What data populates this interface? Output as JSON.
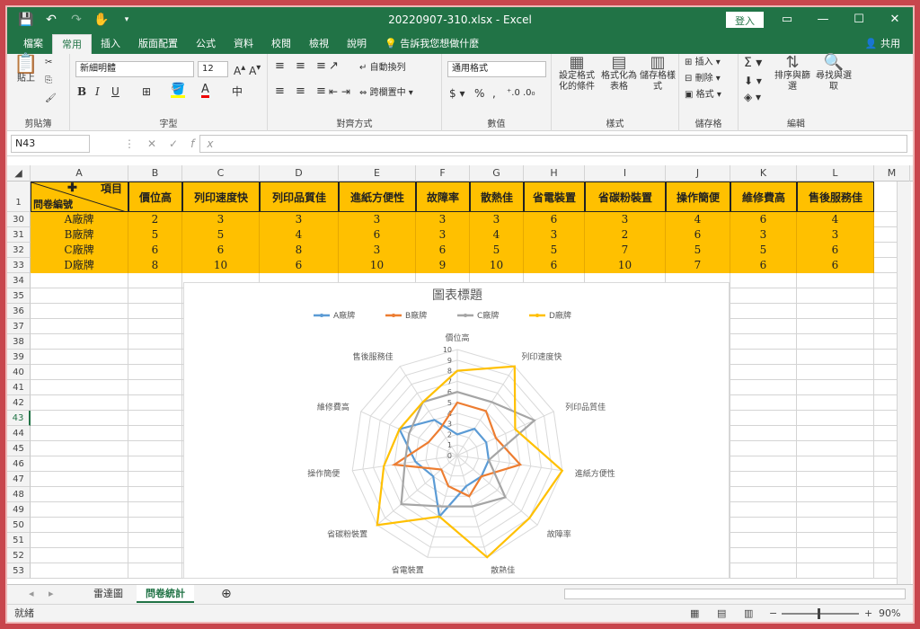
{
  "window": {
    "title": "20220907-310.xlsx  -  Excel",
    "signin": "登入"
  },
  "tabs": [
    "檔案",
    "常用",
    "插入",
    "版面配置",
    "公式",
    "資料",
    "校閱",
    "檢視",
    "說明"
  ],
  "tell_me": "告訴我您想做什麼",
  "share": "共用",
  "ribbon": {
    "clipboard": {
      "paste": "貼上",
      "label": "剪貼簿"
    },
    "font": {
      "name": "新細明體",
      "size": "12",
      "label": "字型"
    },
    "alignment": {
      "wrap": "自動換列",
      "merge": "跨欄置中",
      "label": "對齊方式"
    },
    "number": {
      "format": "通用格式",
      "label": "數值"
    },
    "styles": {
      "conditional": "設定格式化的條件",
      "as_table": "格式化為表格",
      "cell_styles": "儲存格樣式",
      "label": "樣式"
    },
    "cells": {
      "insert": "插入",
      "delete": "刪除",
      "format": "格式",
      "label": "儲存格"
    },
    "editing": {
      "sort": "排序與篩選",
      "find": "尋找與選取",
      "label": "編輯"
    }
  },
  "formula_bar": {
    "name_box": "N43",
    "formula": ""
  },
  "columns": [
    "A",
    "B",
    "C",
    "D",
    "E",
    "F",
    "G",
    "H",
    "I",
    "J",
    "K",
    "L",
    "M"
  ],
  "header_row": {
    "corner_top": "項目",
    "corner_bottom": "問卷編號",
    "items": [
      "價位高",
      "列印速度快",
      "列印品質佳",
      "進紙方便性",
      "故障率",
      "散熱佳",
      "省電裝置",
      "省碳粉裝置",
      "操作簡便",
      "維修費高",
      "售後服務佳"
    ]
  },
  "rows": [
    {
      "num": "30",
      "brand": "A廠牌",
      "values": [
        2,
        3,
        3,
        3,
        3,
        3,
        6,
        3,
        4,
        6,
        4
      ]
    },
    {
      "num": "31",
      "brand": "B廠牌",
      "values": [
        5,
        5,
        4,
        6,
        3,
        4,
        3,
        2,
        6,
        3,
        3
      ]
    },
    {
      "num": "32",
      "brand": "C廠牌",
      "values": [
        6,
        6,
        8,
        3,
        6,
        5,
        5,
        7,
        5,
        5,
        6
      ]
    },
    {
      "num": "33",
      "brand": "D廠牌",
      "values": [
        8,
        10,
        6,
        10,
        9,
        10,
        6,
        10,
        7,
        6,
        6
      ]
    }
  ],
  "empty_rows": [
    "34",
    "35",
    "36",
    "37",
    "38",
    "39",
    "40",
    "41",
    "42",
    "43",
    "44",
    "45",
    "46",
    "47",
    "48",
    "49",
    "50",
    "51",
    "52",
    "53"
  ],
  "chart_data": {
    "type": "radar",
    "title": "圖表標題",
    "categories": [
      "價位高",
      "列印速度快",
      "列印品質佳",
      "進紙方便性",
      "故障率",
      "散熱佳",
      "省電裝置",
      "省碳粉裝置",
      "操作簡便",
      "維修費高",
      "售後服務佳"
    ],
    "rlim": [
      0,
      10
    ],
    "ticks": [
      0,
      1,
      2,
      3,
      4,
      5,
      6,
      7,
      8,
      9,
      10
    ],
    "legend_position": "top",
    "series": [
      {
        "name": "A廠牌",
        "color": "#5b9bd5",
        "values": [
          2,
          3,
          3,
          3,
          3,
          3,
          6,
          3,
          4,
          6,
          4
        ]
      },
      {
        "name": "B廠牌",
        "color": "#ed7d31",
        "values": [
          5,
          5,
          4,
          6,
          3,
          4,
          3,
          2,
          6,
          3,
          3
        ]
      },
      {
        "name": "C廠牌",
        "color": "#a5a5a5",
        "values": [
          6,
          6,
          8,
          3,
          6,
          5,
          5,
          7,
          5,
          5,
          6
        ]
      },
      {
        "name": "D廠牌",
        "color": "#ffc000",
        "values": [
          8,
          10,
          6,
          10,
          9,
          10,
          6,
          10,
          7,
          6,
          6
        ]
      }
    ]
  },
  "sheets": [
    "雷達圖",
    "問卷統計"
  ],
  "active_sheet": "問卷統計",
  "status": {
    "ready": "就緒",
    "zoom": "90%"
  }
}
